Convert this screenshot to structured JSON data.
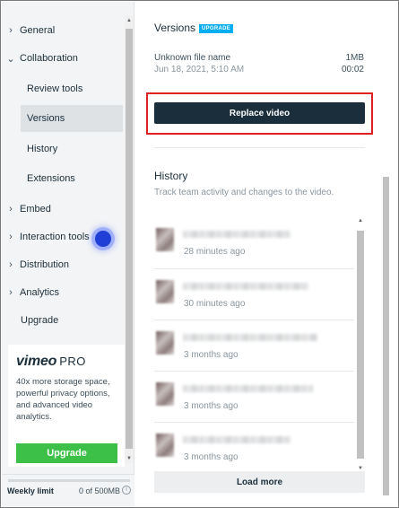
{
  "sidebar": {
    "items": [
      {
        "id": "general",
        "label": "General",
        "chevron": "›"
      },
      {
        "id": "collaboration",
        "label": "Collaboration",
        "chevron": "⌄"
      },
      {
        "id": "embed",
        "label": "Embed",
        "chevron": "›"
      },
      {
        "id": "interaction-tools",
        "label": "Interaction tools",
        "chevron": "›"
      },
      {
        "id": "distribution",
        "label": "Distribution",
        "chevron": "›"
      },
      {
        "id": "analytics",
        "label": "Analytics",
        "chevron": "›"
      },
      {
        "id": "upgrade",
        "label": "Upgrade"
      }
    ],
    "collaboration_sub": [
      {
        "id": "review-tools",
        "label": "Review tools"
      },
      {
        "id": "versions",
        "label": "Versions",
        "active": true
      },
      {
        "id": "history",
        "label": "History"
      },
      {
        "id": "extensions",
        "label": "Extensions"
      }
    ],
    "pro_card": {
      "logo": "vimeo",
      "logo_suffix": "PRO",
      "description": "40x more storage space, powerful privacy options, and advanced video analytics.",
      "button": "Upgrade"
    },
    "weekly_limit": {
      "label": "Weekly limit",
      "value": "0 of 500MB",
      "used_fraction": 0
    }
  },
  "versions": {
    "title": "Versions",
    "badge": "UPGRADE",
    "file_name": "Unknown file name",
    "file_size": "1MB",
    "date": "Jun 18, 2021, 5:10 AM",
    "duration": "00:02",
    "replace_button": "Replace video"
  },
  "history": {
    "title": "History",
    "subtitle": "Track team activity and changes to the video.",
    "items": [
      {
        "time": "28 minutes ago"
      },
      {
        "time": "30 minutes ago"
      },
      {
        "time": "3 months ago"
      },
      {
        "time": "3 months ago"
      },
      {
        "time": "3 months ago"
      }
    ],
    "load_more": "Load more"
  },
  "colors": {
    "accent_dark": "#1a2e3b",
    "badge_blue": "#00adef",
    "upgrade_green": "#3cc047",
    "highlight_red": "#e02020",
    "focus_blue": "#1f3fd6"
  },
  "icons": {
    "chevron_right": "chevron-right-icon",
    "chevron_down": "chevron-down-icon",
    "info": "info-icon",
    "scroll_up": "scroll-up-icon",
    "scroll_down": "scroll-down-icon"
  }
}
